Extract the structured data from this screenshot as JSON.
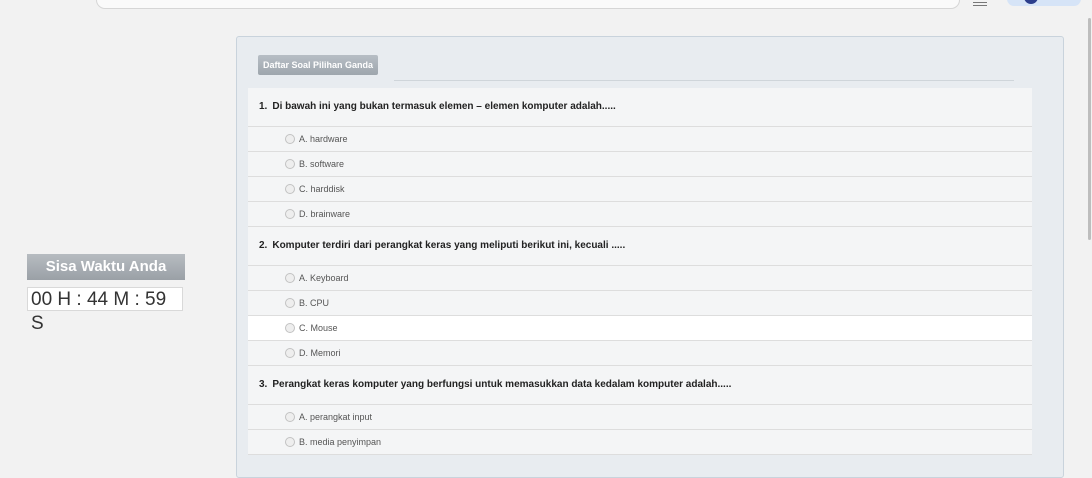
{
  "timer": {
    "label": "Sisa Waktu Anda",
    "value": "00 H : 44 M : 59 S"
  },
  "panel": {
    "header": "Daftar Soal Pilihan Ganda"
  },
  "questions": [
    {
      "number": "1.",
      "text": "Di bawah ini yang bukan termasuk elemen – elemen komputer adalah.....",
      "options": [
        "A. hardware",
        "B. software",
        "C. harddisk",
        "D. brainware"
      ]
    },
    {
      "number": "2.",
      "text": "Komputer terdiri dari perangkat keras yang meliputi berikut ini, kecuali .....",
      "options": [
        "A. Keyboard",
        "B. CPU",
        "C. Mouse",
        "D. Memori"
      ]
    },
    {
      "number": "3.",
      "text": "Perangkat keras komputer yang berfungsi untuk memasukkan data kedalam komputer adalah.....",
      "options": [
        "A. perangkat input",
        "B. media penyimpan"
      ]
    }
  ],
  "colors": {
    "page_bg": "#f2f2f2",
    "panel_bg": "#e8ecf0",
    "header_bg": "#a4abb2",
    "timer_label_bg": "#9aa0a6"
  }
}
